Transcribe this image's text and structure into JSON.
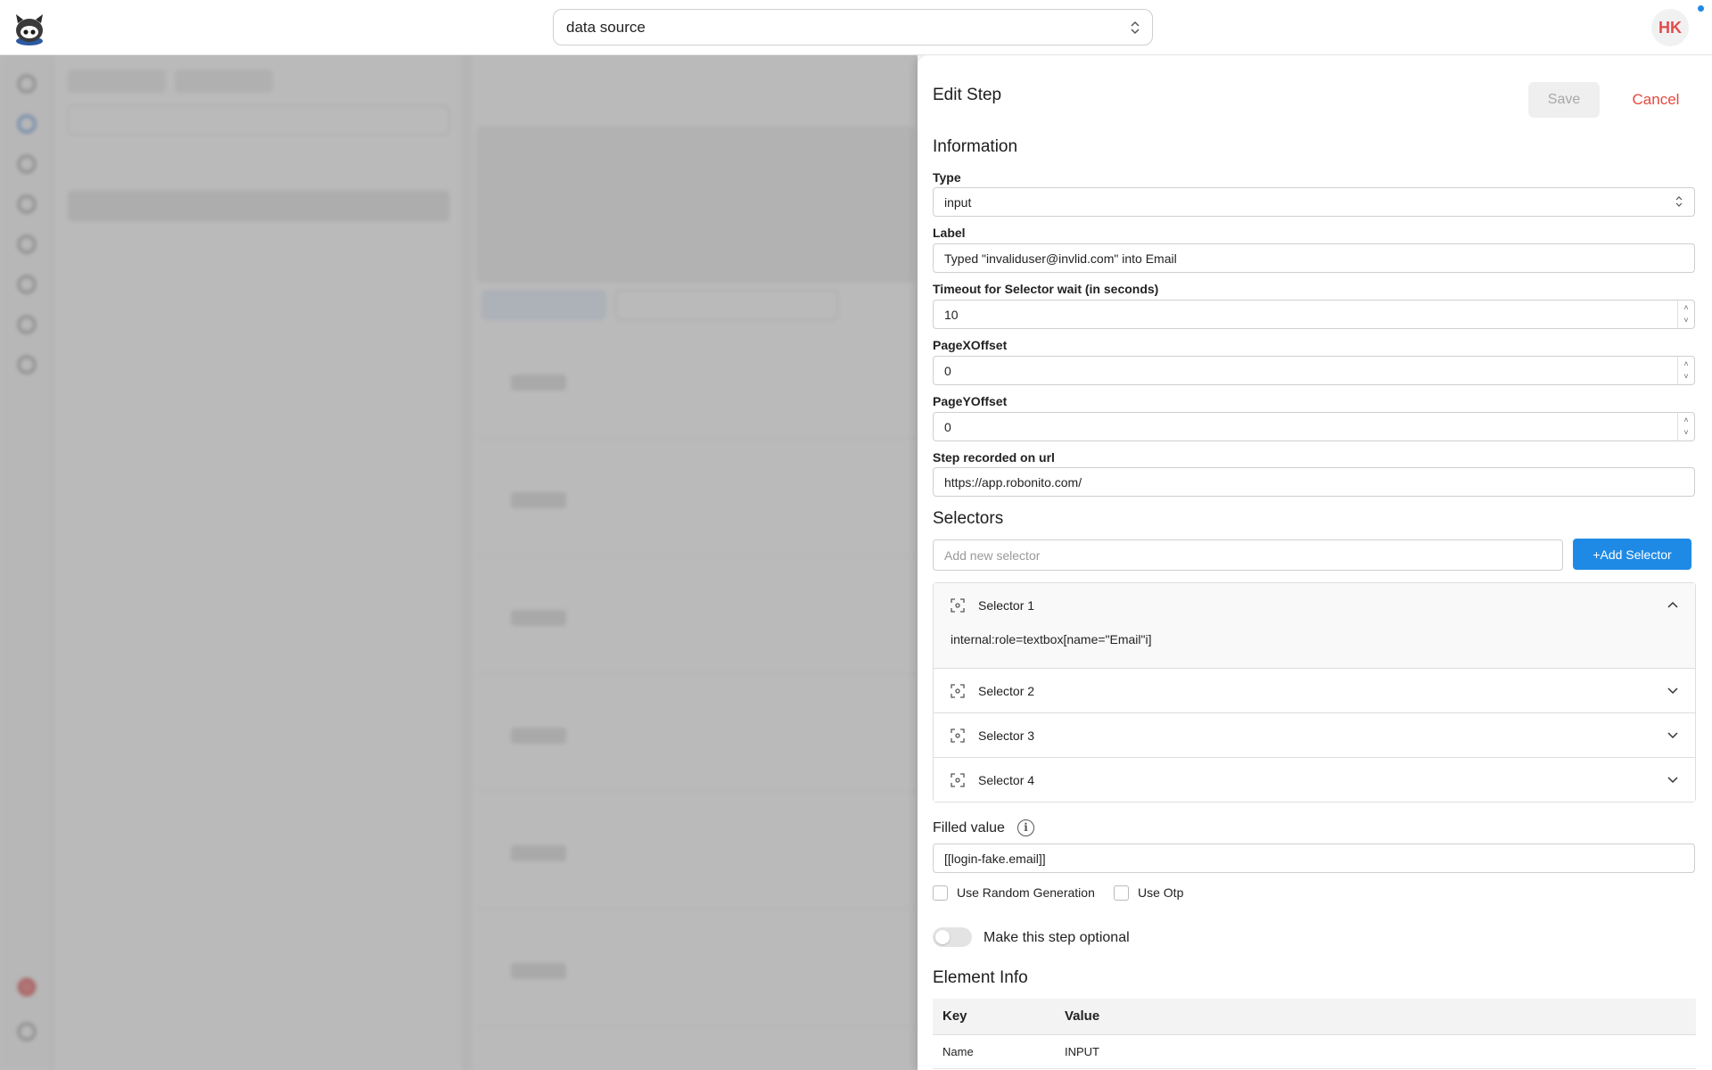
{
  "topbar": {
    "project": "data source",
    "avatar_initials": "HK"
  },
  "panel": {
    "title": "Edit Step",
    "save_label": "Save",
    "cancel_label": "Cancel",
    "information": {
      "heading": "Information",
      "type_label": "Type",
      "type_value": "input",
      "label_label": "Label",
      "label_value": "Typed \"invaliduser@invlid.com\" into Email",
      "timeout_label": "Timeout for Selector wait (in seconds)",
      "timeout_value": "10",
      "pagex_label": "PageXOffset",
      "pagex_value": "0",
      "pagey_label": "PageYOffset",
      "pagey_value": "0",
      "url_label": "Step recorded on url",
      "url_value": "https://app.robonito.com/"
    },
    "selectors": {
      "heading": "Selectors",
      "add_placeholder": "Add new selector",
      "add_button": "+Add Selector",
      "items": [
        {
          "title": "Selector 1",
          "value": "internal:role=textbox[name=\"Email\"i]"
        },
        {
          "title": "Selector 2"
        },
        {
          "title": "Selector 3"
        },
        {
          "title": "Selector 4"
        }
      ]
    },
    "filled_value": {
      "label": "Filled value",
      "value": "[[login-fake.email]]",
      "random_label": "Use Random Generation",
      "otp_label": "Use Otp"
    },
    "optional_label": "Make this step optional",
    "element_info": {
      "heading": "Element Info",
      "columns": [
        "Key",
        "Value"
      ],
      "rows": [
        [
          "Name",
          "INPUT"
        ]
      ]
    }
  },
  "colors": {
    "accent": "#1f8ae6",
    "danger": "#e5483e"
  }
}
